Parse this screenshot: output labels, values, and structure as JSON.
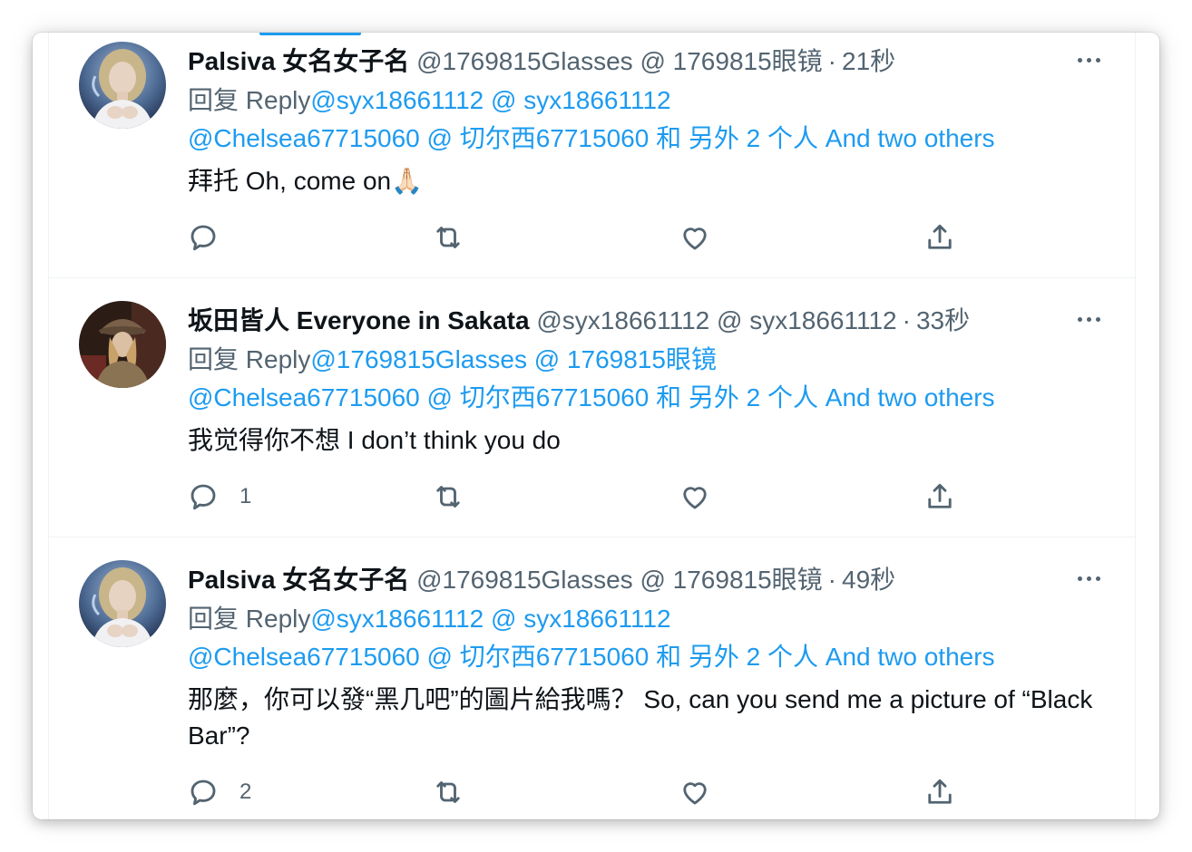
{
  "tweets": [
    {
      "name": "Palsiva 女名女子名",
      "handle": "@1769815Glasses @ 1769815眼镜",
      "separator": "·",
      "time": "21秒",
      "reply_prefix": "回复  Reply",
      "reply_to": "@syx18661112 @ syx18661112",
      "mentions": "@Chelsea67715060 @ 切尔西67715060 和 另外 2 个人 And two others",
      "text": "拜托 Oh, come on",
      "emoji": "🙏🏻",
      "reply_count": "",
      "avatar": "blonde-heroine"
    },
    {
      "name": "坂田皆人 Everyone in Sakata",
      "handle": "@syx18661112 @ syx18661112",
      "separator": "·",
      "time": "33秒",
      "reply_prefix": "回复  Reply",
      "reply_to": "@1769815Glasses @ 1769815眼镜",
      "mentions": "@Chelsea67715060 @ 切尔西67715060 和 另外 2 个人 And two others",
      "text": "我觉得你不想 I don’t think you do",
      "emoji": "",
      "reply_count": "1",
      "avatar": "woman-in-hat"
    },
    {
      "name": "Palsiva 女名女子名",
      "handle": "@1769815Glasses @ 1769815眼镜",
      "separator": "·",
      "time": "49秒",
      "reply_prefix": "回复  Reply",
      "reply_to": "@syx18661112 @ syx18661112",
      "mentions": "@Chelsea67715060 @ 切尔西67715060 和 另外 2 个人 And two others",
      "text": "那麼，你可以發“黑几吧”的圖片給我嗎？  So, can you send me a picture of “Black Bar”?",
      "emoji": "",
      "reply_count": "2",
      "avatar": "blonde-heroine"
    }
  ],
  "icons": {
    "reply": "reply-icon",
    "retweet": "retweet-icon",
    "like": "heart-icon",
    "share": "share-icon",
    "more": "more-icon"
  },
  "colors": {
    "link": "#1d9bf0",
    "text": "#0f1419",
    "secondary": "#536471",
    "divider": "#eff3f4"
  }
}
